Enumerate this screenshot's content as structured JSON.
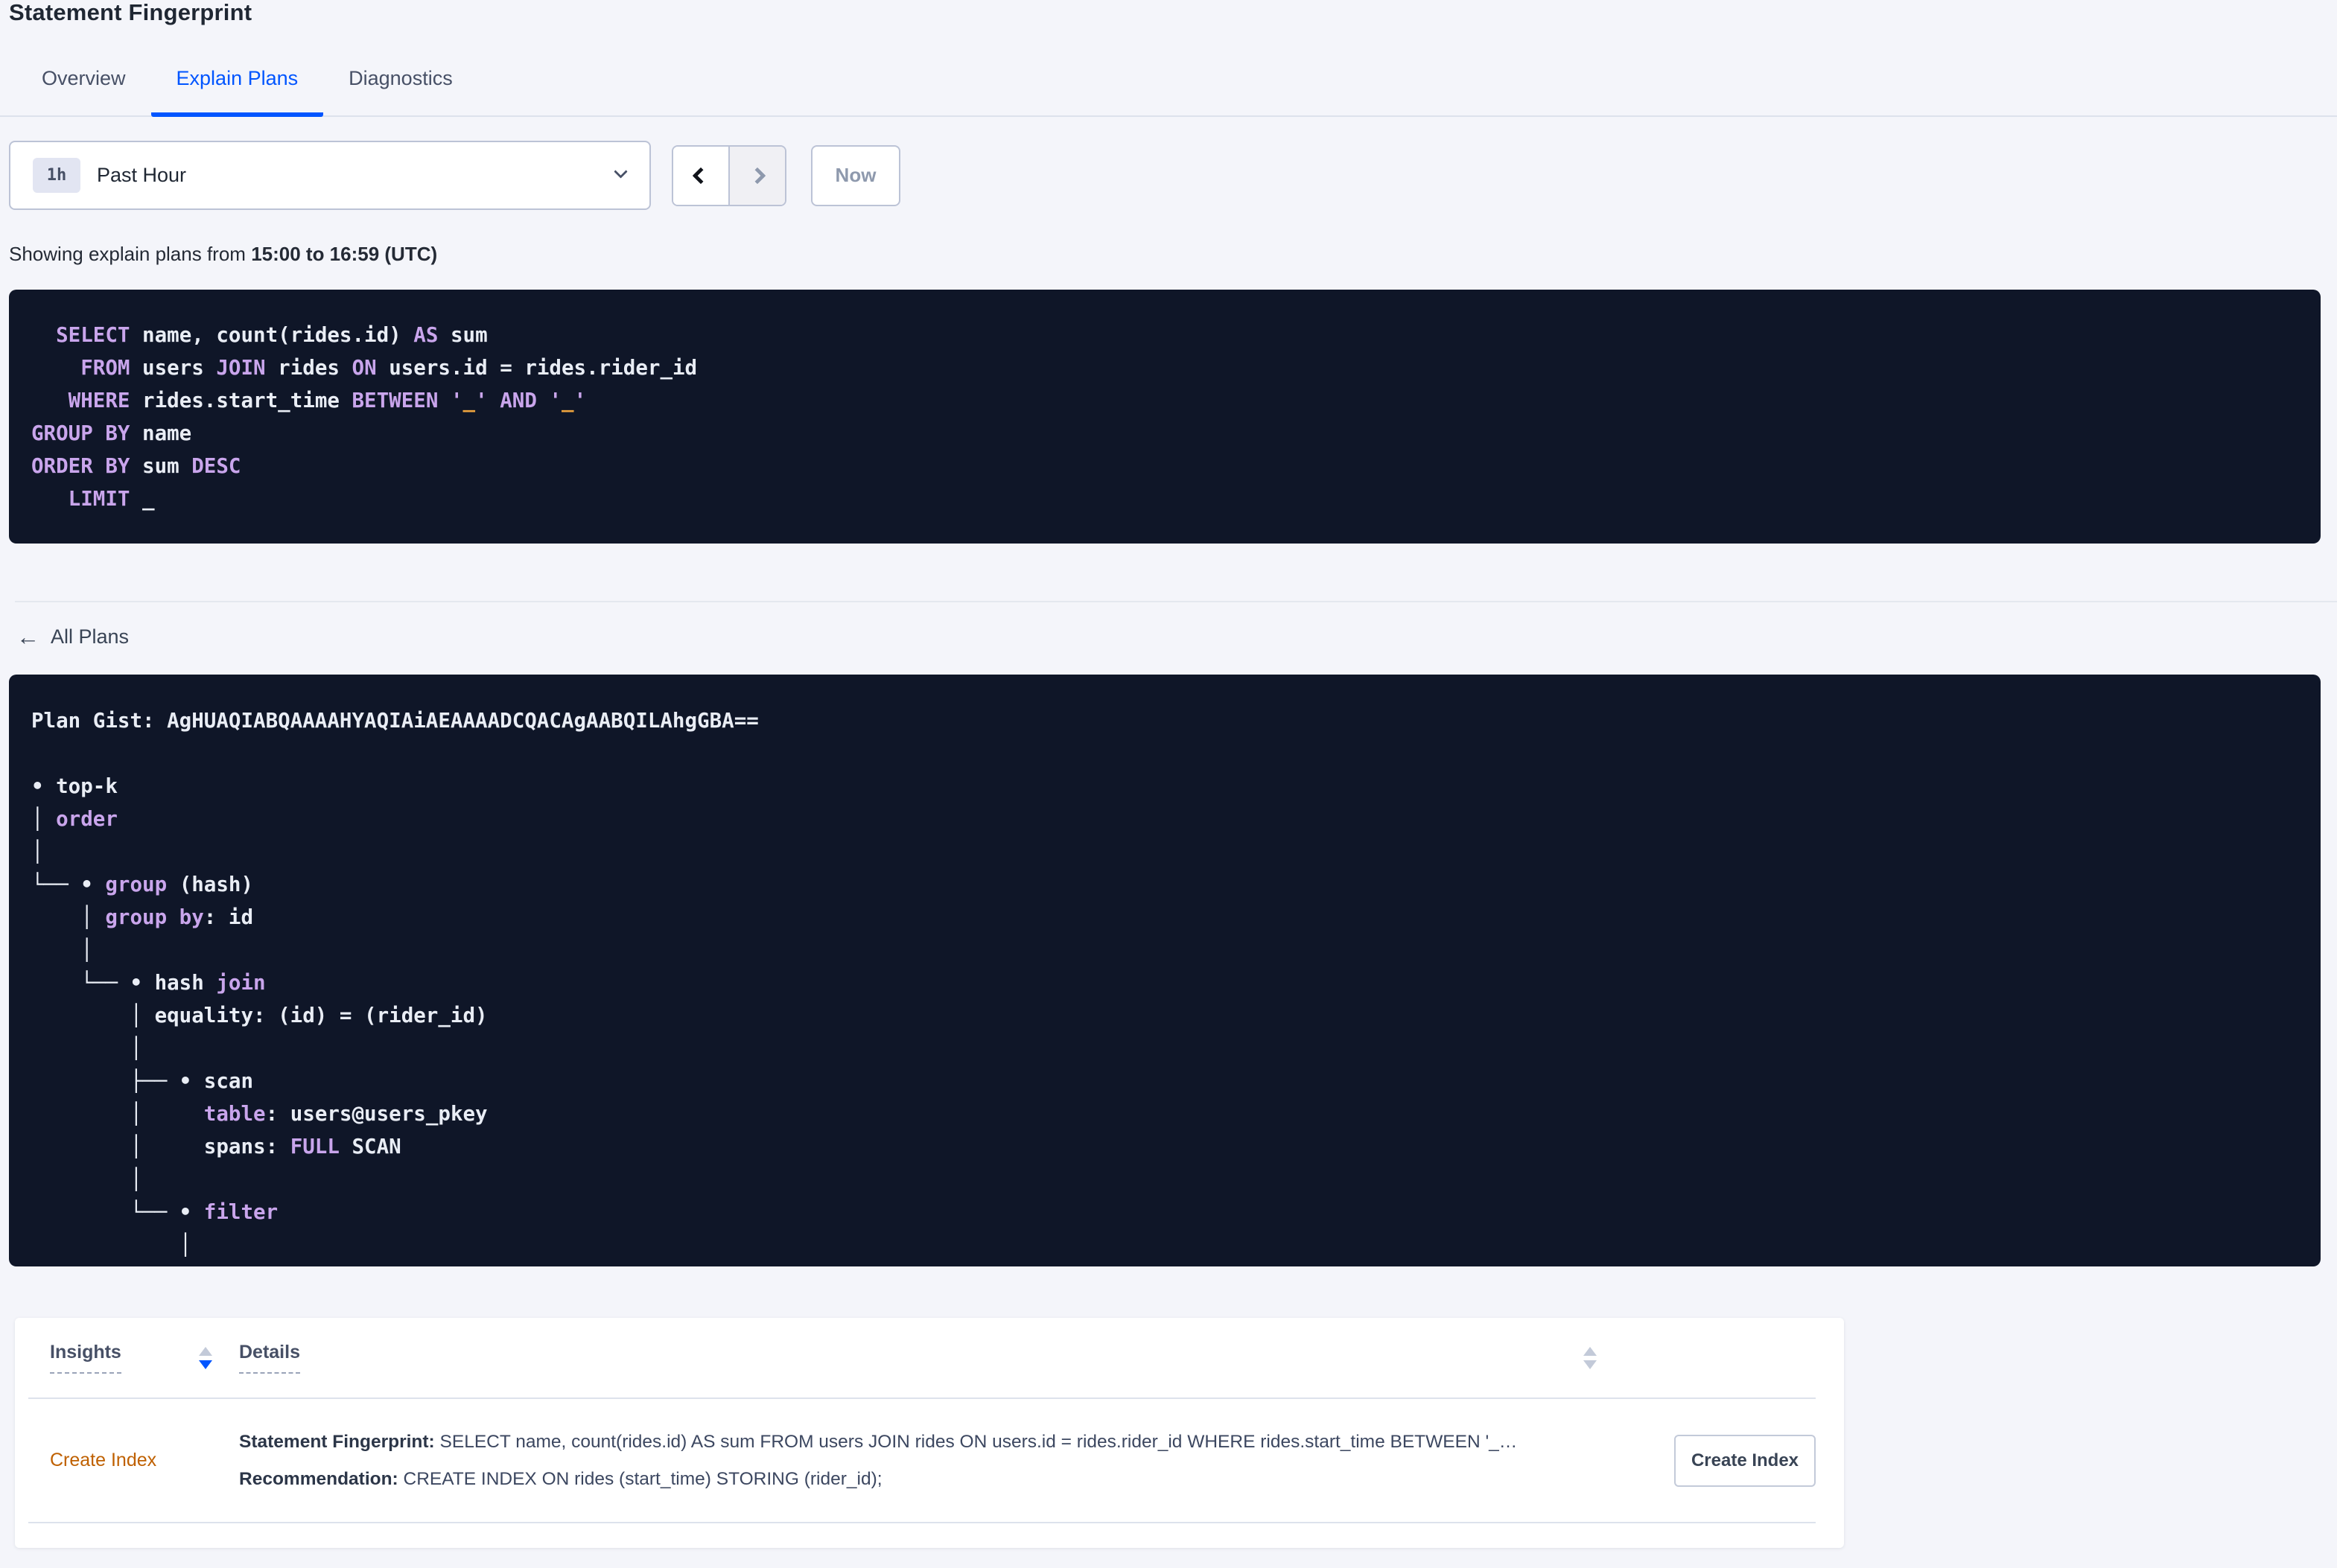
{
  "page": {
    "title": "Statement Fingerprint"
  },
  "tabs": [
    {
      "label": "Overview"
    },
    {
      "label": "Explain Plans"
    },
    {
      "label": "Diagnostics"
    }
  ],
  "time_picker": {
    "badge": "1h",
    "selected": "Past Hour",
    "now_label": "Now"
  },
  "subtitle": {
    "prefix": "Showing explain plans from ",
    "range": "15:00 to 16:59 (UTC)"
  },
  "sql_statement": {
    "lines": [
      [
        [
          "p",
          "  "
        ],
        [
          "k",
          "SELECT"
        ],
        [
          "p",
          " name, count(rides.id) "
        ],
        [
          "k",
          "AS"
        ],
        [
          "p",
          " sum"
        ]
      ],
      [
        [
          "p",
          "    "
        ],
        [
          "k",
          "FROM"
        ],
        [
          "p",
          " users "
        ],
        [
          "k",
          "JOIN"
        ],
        [
          "p",
          " rides "
        ],
        [
          "k",
          "ON"
        ],
        [
          "p",
          " users.id = rides.rider_id"
        ]
      ],
      [
        [
          "p",
          "   "
        ],
        [
          "k",
          "WHERE"
        ],
        [
          "p",
          " rides.start_time "
        ],
        [
          "k",
          "BETWEEN"
        ],
        [
          "p",
          " "
        ],
        [
          "k",
          "'"
        ],
        [
          "o",
          "_"
        ],
        [
          "k",
          "'"
        ],
        [
          "p",
          " "
        ],
        [
          "k",
          "AND"
        ],
        [
          "p",
          " "
        ],
        [
          "k",
          "'"
        ],
        [
          "o",
          "_"
        ],
        [
          "k",
          "'"
        ]
      ],
      [
        [
          "k",
          "GROUP BY"
        ],
        [
          "p",
          " name"
        ]
      ],
      [
        [
          "k",
          "ORDER BY"
        ],
        [
          "p",
          " sum "
        ],
        [
          "k",
          "DESC"
        ]
      ],
      [
        [
          "p",
          "   "
        ],
        [
          "k",
          "LIMIT"
        ],
        [
          "p",
          " _"
        ]
      ]
    ]
  },
  "plans_nav": {
    "back_label": "All Plans"
  },
  "plan_gist": {
    "lines": [
      [
        [
          "p",
          "Plan Gist: AgHUAQIABQAAAAHYAQIAiAEAAAADCQACAgAABQILAhgGBA=="
        ]
      ],
      [
        [
          "p",
          " "
        ]
      ],
      [
        [
          "p",
          "• top-k"
        ]
      ],
      [
        [
          "p",
          "│ "
        ],
        [
          "k",
          "order"
        ]
      ],
      [
        [
          "p",
          "│"
        ]
      ],
      [
        [
          "p",
          "└── • "
        ],
        [
          "k",
          "group"
        ],
        [
          "p",
          " (hash)"
        ]
      ],
      [
        [
          "p",
          "    │ "
        ],
        [
          "k",
          "group by"
        ],
        [
          "p",
          ": id"
        ]
      ],
      [
        [
          "p",
          "    │"
        ]
      ],
      [
        [
          "p",
          "    └── • hash "
        ],
        [
          "k",
          "join"
        ]
      ],
      [
        [
          "p",
          "        │ equality: (id) = (rider_id)"
        ]
      ],
      [
        [
          "p",
          "        │"
        ]
      ],
      [
        [
          "p",
          "        ├── • scan"
        ]
      ],
      [
        [
          "p",
          "        │     "
        ],
        [
          "k",
          "table"
        ],
        [
          "p",
          ": users@users_pkey"
        ]
      ],
      [
        [
          "p",
          "        │     spans: "
        ],
        [
          "k",
          "FULL"
        ],
        [
          "p",
          " SCAN"
        ]
      ],
      [
        [
          "p",
          "        │"
        ]
      ],
      [
        [
          "p",
          "        └── • "
        ],
        [
          "k",
          "filter"
        ]
      ],
      [
        [
          "p",
          "            │"
        ]
      ]
    ]
  },
  "insights": {
    "columns": [
      {
        "label": "Insights"
      },
      {
        "label": "Details"
      }
    ],
    "rows": [
      {
        "insight": "Create Index",
        "statement_label": "Statement Fingerprint:",
        "statement": " SELECT name, count(rides.id) AS sum FROM users JOIN rides ON users.id = rides.rider_id WHERE rides.start_time BETWEEN '_…",
        "recommendation_label": "Recommendation:",
        "recommendation": " CREATE INDEX ON rides (start_time) STORING (rider_id);",
        "action": "Create Index"
      }
    ]
  },
  "colors": {
    "accent_blue": "#0055ff",
    "code_background": "#0f1628",
    "code_keyword": "#c9a5ec",
    "code_placeholder": "#efa43e",
    "insight_link": "#bf6000"
  }
}
